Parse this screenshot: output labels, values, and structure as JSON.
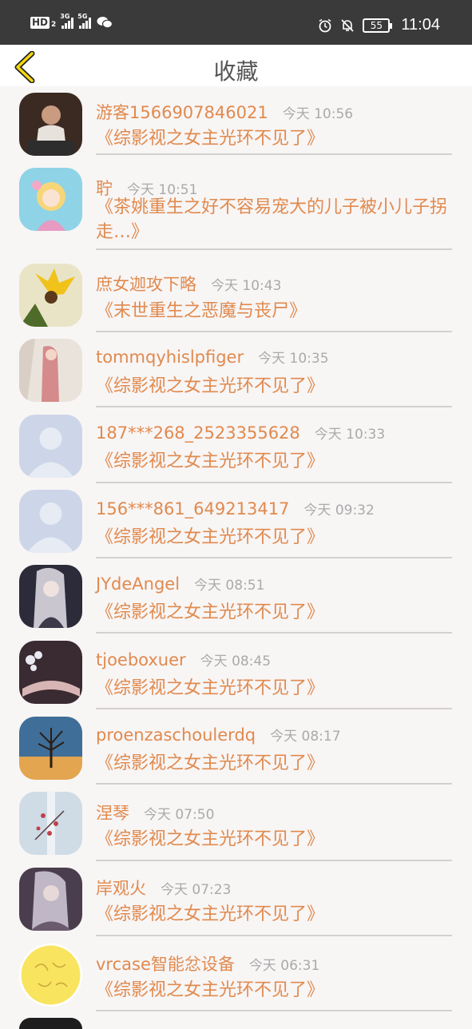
{
  "status_bar": {
    "hd": "HD",
    "hd_sub": "2",
    "sig1": "3G",
    "sig2": "5G",
    "battery": "55",
    "time": "11:04"
  },
  "header": {
    "title": "收藏"
  },
  "items": [
    {
      "name": "游客1566907846021",
      "time": "今天 10:56",
      "book": "《综影视之女主光环不见了》"
    },
    {
      "name": "聍",
      "time": "今天 10:51",
      "book": "《茶姚重生之好不容易宠大的儿子被小儿子拐走…》"
    },
    {
      "name": "庶女迦攻下略",
      "time": "今天 10:43",
      "book": "《末世重生之恶魔与丧尸》"
    },
    {
      "name": "tommqyhislpfiger",
      "time": "今天 10:35",
      "book": "《综影视之女主光环不见了》"
    },
    {
      "name": "187***268_2523355628",
      "time": "今天 10:33",
      "book": "《综影视之女主光环不见了》"
    },
    {
      "name": "156***861_649213417",
      "time": "今天 09:32",
      "book": "《综影视之女主光环不见了》"
    },
    {
      "name": "JYdeAngel",
      "time": "今天 08:51",
      "book": "《综影视之女主光环不见了》"
    },
    {
      "name": "tjoeboxuer",
      "time": "今天 08:45",
      "book": "《综影视之女主光环不见了》"
    },
    {
      "name": "proenzaschoulerdq",
      "time": "今天 08:17",
      "book": "《综影视之女主光环不见了》"
    },
    {
      "name": "涅琴",
      "time": "今天 07:50",
      "book": "《综影视之女主光环不见了》"
    },
    {
      "name": "岸观火",
      "time": "今天 07:23",
      "book": "《综影视之女主光环不见了》"
    },
    {
      "name": "vrcase智能忿设备",
      "time": "今天 06:31",
      "book": "《综影视之女主光环不见了》"
    }
  ]
}
